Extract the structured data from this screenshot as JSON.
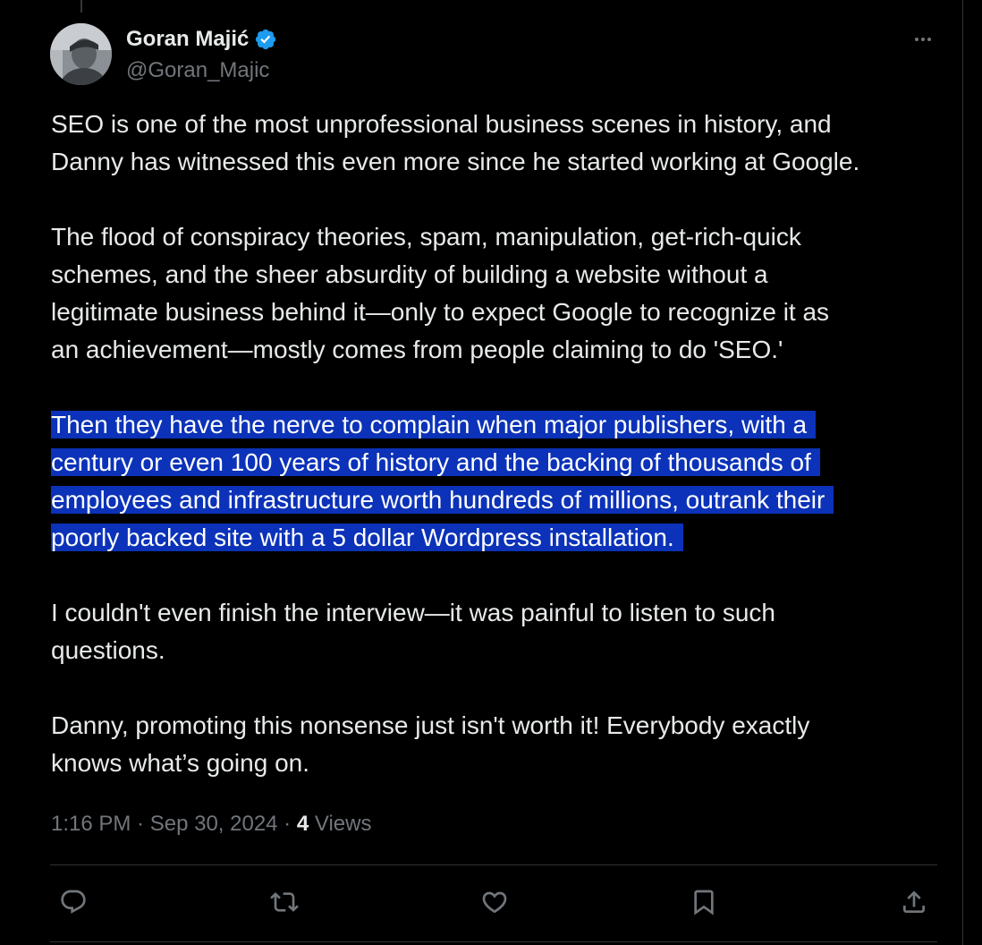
{
  "author": {
    "display_name": "Goran Majić",
    "handle": "@Goran_Majic",
    "avatar_icon": "avatar-photo",
    "verified": true,
    "verified_color": "#1d9bf0"
  },
  "tweet": {
    "paragraphs": [
      {
        "lines": [
          "SEO is one of the most unprofessional business scenes in history, and",
          "Danny has witnessed this even more since he started working at Google."
        ],
        "highlighted": false
      },
      {
        "lines": [
          "The flood of conspiracy theories, spam, manipulation, get-rich-quick",
          "schemes, and the sheer absurdity of building a website without a",
          "legitimate business behind it—only to expect Google to recognize it as",
          "an achievement—mostly comes from people claiming to do 'SEO.'"
        ],
        "highlighted": false
      },
      {
        "lines": [
          "Then they have the nerve to complain when major publishers, with a",
          "century or even 100 years of history and the backing of thousands of",
          "employees and infrastructure worth hundreds of millions, outrank their",
          "poorly backed site with a 5 dollar Wordpress installation."
        ],
        "highlighted": true
      },
      {
        "lines": [
          "I couldn't even finish the interview—it was painful to listen to such",
          "questions."
        ],
        "highlighted": false
      },
      {
        "lines": [
          "Danny, promoting this nonsense just isn't worth it! Everybody exactly",
          "knows what’s going on."
        ],
        "highlighted": false
      }
    ]
  },
  "meta": {
    "time": "1:16 PM",
    "separator": " · ",
    "date": "Sep 30, 2024",
    "views_count": "4",
    "views_label": "Views"
  },
  "actions": {
    "reply_icon": "reply-icon",
    "repost_icon": "repost-icon",
    "like_icon": "heart-icon",
    "bookmark_icon": "bookmark-icon",
    "share_icon": "share-icon"
  },
  "colors": {
    "background": "#000000",
    "text": "#e7e9ea",
    "secondary": "#71767b",
    "highlight": "#0b32b8"
  }
}
